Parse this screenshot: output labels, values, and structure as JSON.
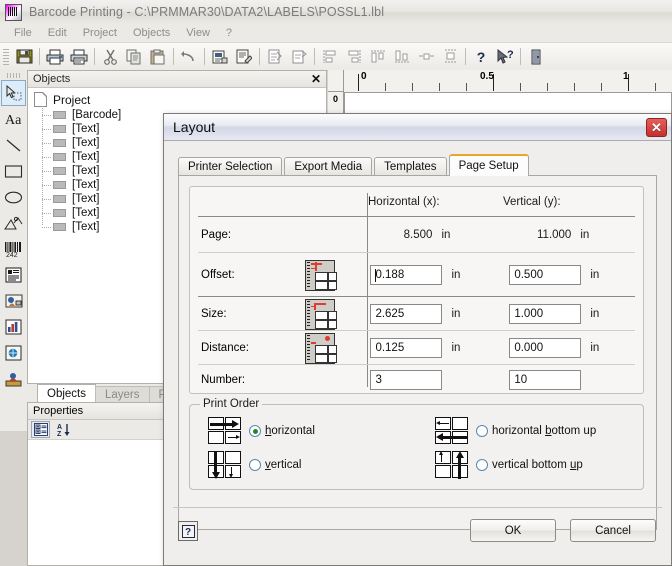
{
  "app": {
    "icon": "barcode-app-icon",
    "title": "Barcode Printing - C:\\PRMMAR30\\DATA2\\LABELS\\POSSL1.lbl",
    "menu": [
      "File",
      "Edit",
      "Project",
      "Objects",
      "View",
      "?"
    ],
    "toolbar_icons": [
      "save-icon",
      "print-icon",
      "print-preview-icon",
      "cut-icon",
      "copy-icon",
      "paste-icon",
      "undo-icon",
      "project-properties-icon",
      "object-properties-icon",
      "insert-object-icon",
      "edit-object-icon",
      "align-left-icon",
      "align-right-icon",
      "align-top-icon",
      "align-bottom-icon",
      "center-horizontal-icon",
      "distribute-icon",
      "help-icon",
      "context-help-icon",
      "exit-icon"
    ],
    "toolbox_icons": [
      "select-tool-icon",
      "text-tool-icon",
      "line-tool-icon",
      "rectangle-tool-icon",
      "ellipse-tool-icon",
      "drawing-tool-icon",
      "barcode-tool-icon",
      "formatted-text-tool-icon",
      "picture-tool-icon",
      "chart-tool-icon",
      "ole-object-tool-icon",
      "variable-tool-icon"
    ]
  },
  "objects_panel": {
    "title": "Objects",
    "close_icon": "close-icon",
    "root": "Project",
    "items": [
      "[Barcode]",
      "[Text]",
      "[Text]",
      "[Text]",
      "[Text]",
      "[Text]",
      "[Text]",
      "[Text]",
      "[Text]"
    ]
  },
  "panel_tabs": [
    {
      "label": "Objects",
      "active": true
    },
    {
      "label": "Layers",
      "active": false
    },
    {
      "label": "Previe",
      "active": false
    }
  ],
  "properties_panel": {
    "title": "Properties",
    "buttons": [
      "categorized-view-icon",
      "sort-alphabetical-icon"
    ]
  },
  "ruler": {
    "unit_origin": "0",
    "labels": [
      "0",
      "0.5",
      "1"
    ],
    "vertical_origin": "0"
  },
  "dialog": {
    "title": "Layout",
    "close_icon": "close-icon",
    "tabs": [
      {
        "label": "Printer Selection",
        "active": false
      },
      {
        "label": "Export Media",
        "active": false
      },
      {
        "label": "Templates",
        "active": false
      },
      {
        "label": "Page Setup",
        "active": true
      }
    ],
    "accent_color": "#eaa52b",
    "grid": {
      "columns": [
        "",
        "Horizontal (x):",
        "Vertical (y):"
      ],
      "rows": [
        {
          "label": "Page:",
          "icon": null,
          "editable": false,
          "x_value": "8.500",
          "x_unit": "in",
          "y_value": "11.000",
          "y_unit": "in"
        },
        {
          "label": "Offset:",
          "icon": "label-offset-diagram-icon",
          "editable": true,
          "x_value": "0.188",
          "x_unit": "in",
          "y_value": "0.500",
          "y_unit": "in",
          "focused": true
        },
        {
          "label": "Size:",
          "icon": "label-size-diagram-icon",
          "editable": true,
          "x_value": "2.625",
          "x_unit": "in",
          "y_value": "1.000",
          "y_unit": "in"
        },
        {
          "label": "Distance:",
          "icon": "label-distance-diagram-icon",
          "editable": true,
          "x_value": "0.125",
          "x_unit": "in",
          "y_value": "0.000",
          "y_unit": "in"
        },
        {
          "label": "Number:",
          "icon": null,
          "editable": true,
          "x_value": "3",
          "x_unit": "",
          "y_value": "10",
          "y_unit": ""
        }
      ]
    },
    "print_order": {
      "legend": "Print Order",
      "options": [
        {
          "label": "horizontal",
          "mnemonic": "h",
          "selected": true,
          "icon": "print-order-horizontal-icon"
        },
        {
          "label": "vertical",
          "mnemonic": "v",
          "selected": false,
          "icon": "print-order-vertical-icon"
        },
        {
          "label": "horizontal bottom up",
          "mnemonic": "b",
          "selected": false,
          "icon": "print-order-horizontal-bottom-up-icon"
        },
        {
          "label": "vertical bottom up",
          "mnemonic": "u",
          "selected": false,
          "icon": "print-order-vertical-bottom-up-icon"
        }
      ]
    },
    "footer": {
      "help_label": "?",
      "ok_label": "OK",
      "cancel_label": "Cancel"
    }
  }
}
